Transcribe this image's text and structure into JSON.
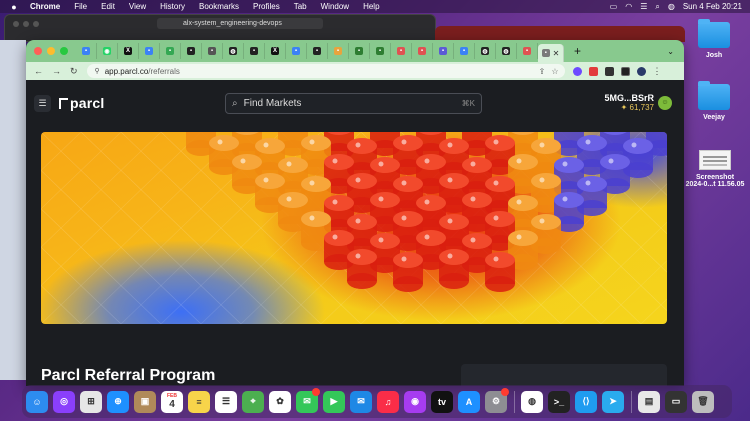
{
  "menubar": {
    "apple": "",
    "app_name": "Chrome",
    "menus": [
      "File",
      "Edit",
      "View",
      "History",
      "Bookmarks",
      "Profiles",
      "Tab",
      "Window",
      "Help"
    ],
    "datetime": "Sun 4 Feb  20:21"
  },
  "background_window": {
    "tab_title": "alx-system_engineering-devops"
  },
  "browser": {
    "url_host": "app.parcl.co",
    "url_path": "/referrals",
    "tabs": [
      {
        "icon": "generic-tab-icon",
        "color": "#3b82f6"
      },
      {
        "icon": "whatsapp-icon",
        "color": "#25d366"
      },
      {
        "icon": "x-icon",
        "color": "#111111"
      },
      {
        "icon": "generic-tab-icon",
        "color": "#3b82f6"
      },
      {
        "icon": "generic-tab-icon",
        "color": "#34a853"
      },
      {
        "icon": "generic-tab-icon",
        "color": "#222222"
      },
      {
        "icon": "generic-tab-icon",
        "color": "#555555"
      },
      {
        "icon": "github-icon",
        "color": "#222222"
      },
      {
        "icon": "generic-tab-icon",
        "color": "#222222"
      },
      {
        "icon": "x-icon",
        "color": "#111111"
      },
      {
        "icon": "generic-tab-icon",
        "color": "#3b82f6"
      },
      {
        "icon": "generic-tab-icon",
        "color": "#222222"
      },
      {
        "icon": "generic-tab-icon",
        "color": "#e8a33d"
      },
      {
        "icon": "generic-tab-icon",
        "color": "#2e7d32"
      },
      {
        "icon": "generic-tab-icon",
        "color": "#2e7d32"
      },
      {
        "icon": "generic-tab-icon",
        "color": "#e05252"
      },
      {
        "icon": "generic-tab-icon",
        "color": "#e05252"
      },
      {
        "icon": "generic-tab-icon",
        "color": "#5b5bd6"
      },
      {
        "icon": "generic-tab-icon",
        "color": "#3b82f6"
      },
      {
        "icon": "github-icon",
        "color": "#222222"
      },
      {
        "icon": "github-icon",
        "color": "#222222"
      },
      {
        "icon": "generic-tab-icon",
        "color": "#e05252"
      }
    ]
  },
  "parcl": {
    "logo": "parcl",
    "search_placeholder": "Find Markets",
    "search_shortcut": "⌘K",
    "wallet_address": "5MG...BSrR",
    "points": "✦ 61,737",
    "title": "Parcl Referral Program"
  },
  "desktop": {
    "icons": [
      {
        "label": "Josh"
      },
      {
        "label": "Veejay"
      },
      {
        "label_line1": "Screenshot",
        "label_line2": "2024-0...t 11.56.05"
      }
    ]
  },
  "dock": {
    "calendar_month": "FEB",
    "calendar_day": "4",
    "apps": [
      {
        "name": "finder-icon",
        "color": "#2d8cf0"
      },
      {
        "name": "siri-icon",
        "color": "#8a3ffc"
      },
      {
        "name": "launchpad-icon",
        "color": "#e6e6e6"
      },
      {
        "name": "safari-icon",
        "color": "#1e90ff"
      },
      {
        "name": "contacts-icon",
        "color": "#b08a5a"
      },
      {
        "name": "calendar-icon",
        "color": "#ffffff"
      },
      {
        "name": "notes-icon",
        "color": "#f7d44a"
      },
      {
        "name": "reminders-icon",
        "color": "#ffffff"
      },
      {
        "name": "maps-icon",
        "color": "#4caf50"
      },
      {
        "name": "photos-icon",
        "color": "#ffffff"
      },
      {
        "name": "messages-icon",
        "color": "#34c759"
      },
      {
        "name": "facetime-icon",
        "color": "#34c759"
      },
      {
        "name": "mail-icon",
        "color": "#1e88e5"
      },
      {
        "name": "music-icon",
        "color": "#fa2d48"
      },
      {
        "name": "podcasts-icon",
        "color": "#a63cf0"
      },
      {
        "name": "tv-icon",
        "color": "#111111"
      },
      {
        "name": "appstore-icon",
        "color": "#1e90ff"
      },
      {
        "name": "settings-icon",
        "color": "#8e8e93"
      },
      {
        "name": "chrome-icon",
        "color": "#ffffff"
      },
      {
        "name": "terminal-icon",
        "color": "#222222"
      },
      {
        "name": "vscode-icon",
        "color": "#1f9cf0"
      },
      {
        "name": "telegram-icon",
        "color": "#2aabee"
      },
      {
        "name": "document-icon",
        "color": "#e8e8e8"
      },
      {
        "name": "screen-icon",
        "color": "#333333"
      },
      {
        "name": "trash-icon",
        "color": "#bdbdbd"
      }
    ]
  },
  "colors": {
    "tabbar": "#88c98e",
    "page_bg": "#1b1d21",
    "points": "#e8c75a"
  }
}
